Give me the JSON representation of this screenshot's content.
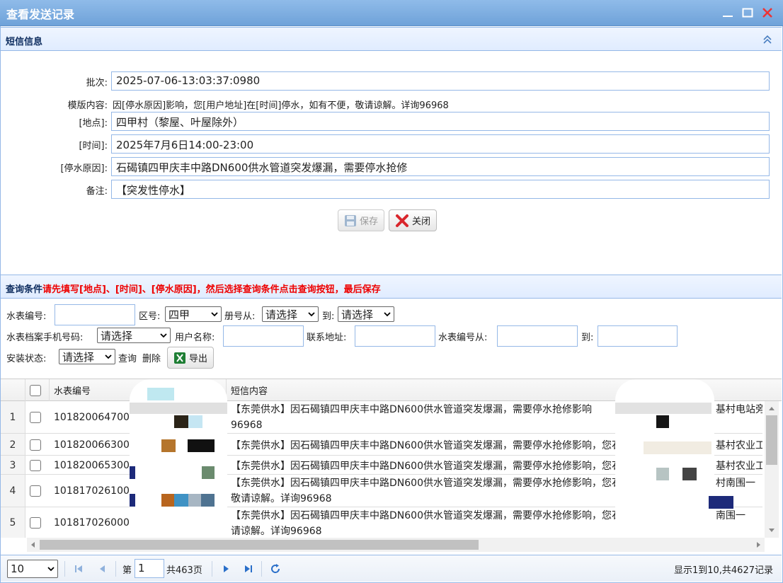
{
  "window": {
    "title": "查看发送记录"
  },
  "sms_panel": {
    "title": "短信信息"
  },
  "form": {
    "batch_label": "批次:",
    "batch_value": "2025-07-06-13:03:37:0980",
    "template_label": "模版内容:",
    "template_value": "因[停水原因]影响，您[用户地址]在[时间]停水，如有不便，敬请谅解。详询96968",
    "place_label": "[地点]:",
    "place_value": "四甲村（黎屋、叶屋除外）",
    "time_label": "[时间]:",
    "time_value": "2025年7月6日14:00-23:00",
    "reason_label": "[停水原因]:",
    "reason_value": "石碣镇四甲庆丰中路DN600供水管道突发爆漏，需要停水抢修",
    "remark_label": "备注:",
    "remark_value": "【突发性停水】"
  },
  "buttons": {
    "save": "保存",
    "close": "关闭",
    "query": "查询",
    "delete": "删除",
    "export": "导出"
  },
  "query_panel": {
    "title": "查询条件",
    "hint": "请先填写[地点]、[时间]、[停水原因]，然后选择查询条件点击查询按钮，最后保存"
  },
  "query": {
    "meter_no_label": "水表编号:",
    "area_label": "区号:",
    "area_value": "四甲",
    "book_from_label": "册号从:",
    "book_from_value": "请选择",
    "to_label": "到:",
    "book_to_value": "请选择",
    "phone_label": "水表档案手机号码:",
    "phone_value": "请选择",
    "username_label": "用户名称:",
    "address_label": "联系地址:",
    "meter_from_label": "水表编号从:",
    "meter_to_label": "到:",
    "install_label": "安装状态:",
    "install_value": "请选择"
  },
  "grid": {
    "col_meter": "水表编号",
    "col_msg": "短信内容",
    "rows": [
      {
        "n": "1",
        "meter": "101820064700",
        "msg": "【东莞供水】因石碣镇四甲庆丰中路DN600供水管道突发爆漏，需要停水抢修影响",
        "msg2": "96968",
        "addr": "基村电站旁"
      },
      {
        "n": "2",
        "meter": "101820066300",
        "msg": "【东莞供水】因石碣镇四甲庆丰中路DN600供水管道突发爆漏，需要停水抢修影响，您石",
        "msg2": "",
        "addr": "基村农业工"
      },
      {
        "n": "3",
        "meter": "101820065300",
        "msg": "【东莞供水】因石碣镇四甲庆丰中路DN600供水管道突发爆漏，需要停水抢修影响，您石碣",
        "msg2": "",
        "addr": "基村农业工"
      },
      {
        "n": "4",
        "meter": "101817026100",
        "msg": "【东莞供水】因石碣镇四甲庆丰中路DN600供水管道突发爆漏，需要停水抢修影响，您石",
        "msg2": "敬请谅解。详询96968",
        "addr": "村南围一"
      },
      {
        "n": "5",
        "meter": "101817026000",
        "msg": "【东莞供水】因石碣镇四甲庆丰中路DN600供水管道突发爆漏，需要停水抢修影响，您石碣",
        "msg2": "请谅解。详询96968",
        "addr": "南围一"
      }
    ]
  },
  "pager": {
    "page_size": "10",
    "page_prefix": "第",
    "page_value": "1",
    "page_suffix": "共463页",
    "summary": "显示1到10,共4627记录"
  }
}
